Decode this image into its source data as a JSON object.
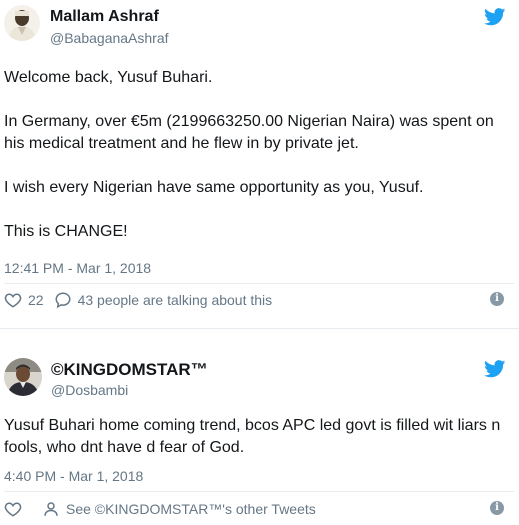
{
  "tweet1": {
    "name": "Mallam Ashraf",
    "handle": "@BabaganaAshraf",
    "body": [
      "Welcome back, Yusuf Buhari.",
      "In Germany, over €5m (2199663250.00 Nigerian Naira) was spent on his medical treatment and he flew in by private jet.",
      "I wish every Nigerian have same opportunity as you, Yusuf.",
      "This is CHANGE!"
    ],
    "timestamp": "12:41 PM - Mar 1, 2018",
    "like_count": "22",
    "conversation_label": "43 people are talking about this",
    "like_icon": "heart-icon",
    "reply_icon": "speech-bubble-icon"
  },
  "tweet2": {
    "name": "©KINGDOMSTAR™",
    "handle": "@Dosbambi",
    "body": "Yusuf Buhari home coming trend, bcos APC led govt is filled wit liars n fools, who dnt have d fear of God.",
    "timestamp": "4:40 PM - Mar 1, 2018",
    "other_tweets_label": "See ©KINGDOMSTAR™'s other Tweets",
    "like_icon": "heart-icon",
    "profile_icon": "person-icon"
  },
  "info_glyph": "i",
  "colors": {
    "twitter_blue": "#1da1f2",
    "text": "#14171a",
    "muted": "#657786",
    "border": "#e6ecf0"
  }
}
